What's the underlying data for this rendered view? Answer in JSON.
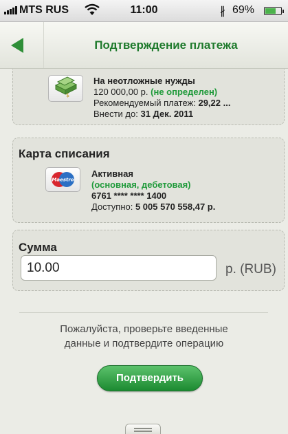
{
  "status_bar": {
    "carrier": "MTS RUS",
    "time": "11:00",
    "battery": "69%",
    "battery_level": 0.69,
    "icons": [
      "signal-icon",
      "wifi-icon",
      "bluetooth-icon",
      "battery-icon"
    ]
  },
  "nav": {
    "title": "Подтверждение платежа",
    "back_icon": "back-arrow-icon"
  },
  "goal": {
    "name": "На неотложные нужды",
    "amount": "120 000,00 р.",
    "status": "(не определен)",
    "recommended_label": "Рекомендуемый платеж:",
    "recommended_value": "29,22 ...",
    "deadline_label": "Внести до:",
    "deadline_value": "31 Дек. 2011",
    "icon": "money-stack-icon"
  },
  "card": {
    "section_title": "Карта списания",
    "state": "Активная",
    "type": "(основная, дебетовая)",
    "number": "6761 **** **** 1400",
    "available_label": "Доступно:",
    "available_value": "5 005 570 558,47 р.",
    "brand": "Maestro"
  },
  "amount": {
    "section_title": "Сумма",
    "value": "10.00",
    "currency": "р. (RUB)"
  },
  "notice": {
    "line1": "Пожалуйста, проверьте введенные",
    "line2": "данные и подтвердите операцию"
  },
  "confirm_label": "Подтвердить",
  "colors": {
    "accent_green": "#1f9a3a",
    "button_green": "#2e9e42",
    "background": "#ebece6"
  }
}
